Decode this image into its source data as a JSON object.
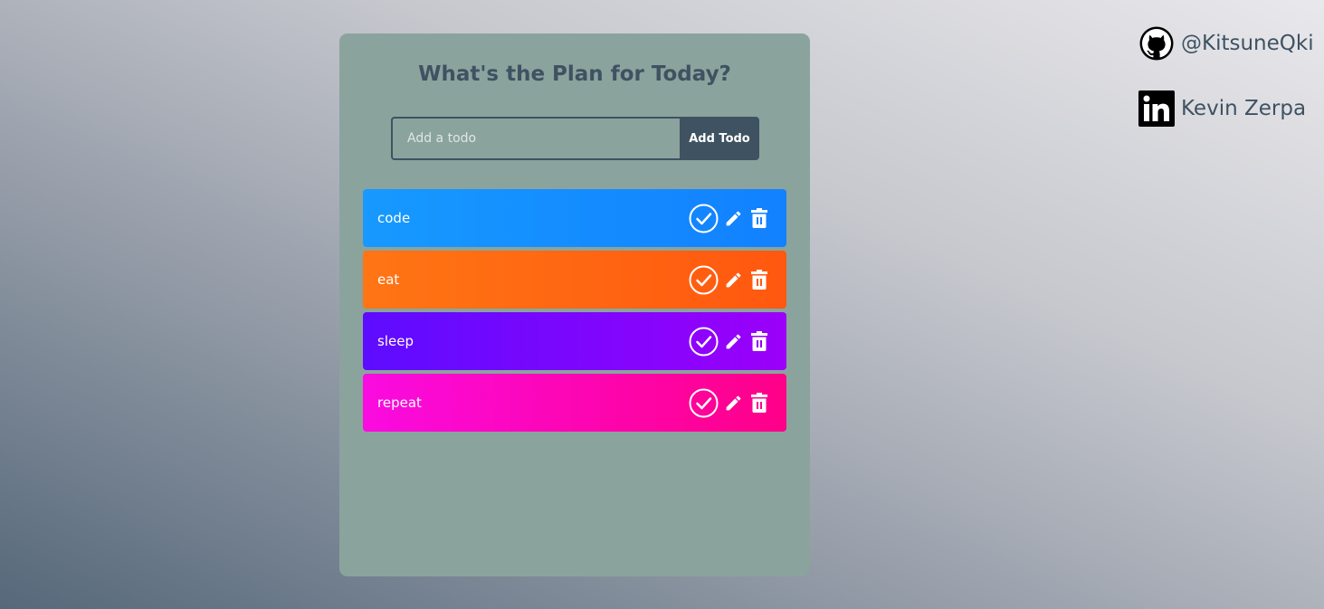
{
  "app": {
    "title": "What's the Plan for Today?"
  },
  "form": {
    "placeholder": "Add a todo",
    "value": "",
    "add_label": "Add Todo"
  },
  "todos": [
    {
      "text": "code",
      "color_from": "#1799ff",
      "color_to": "#1281ff"
    },
    {
      "text": "eat",
      "color_from": "#ff7514",
      "color_to": "#ff5810"
    },
    {
      "text": "sleep",
      "color_from": "#5d0cff",
      "color_to": "#9b00fa"
    },
    {
      "text": "repeat",
      "color_from": "#fa0be0",
      "color_to": "#ff0088"
    }
  ],
  "icons": {
    "complete": "check-circle-icon",
    "edit": "pencil-icon",
    "delete": "trash-icon"
  },
  "social": {
    "github": {
      "icon": "github-icon",
      "label": "@KitsuneQki"
    },
    "linkedin": {
      "icon": "linkedin-icon",
      "label": "Kevin Zerpa"
    }
  },
  "colors": {
    "card": "#8ba39d",
    "accent": "#3e5262"
  }
}
